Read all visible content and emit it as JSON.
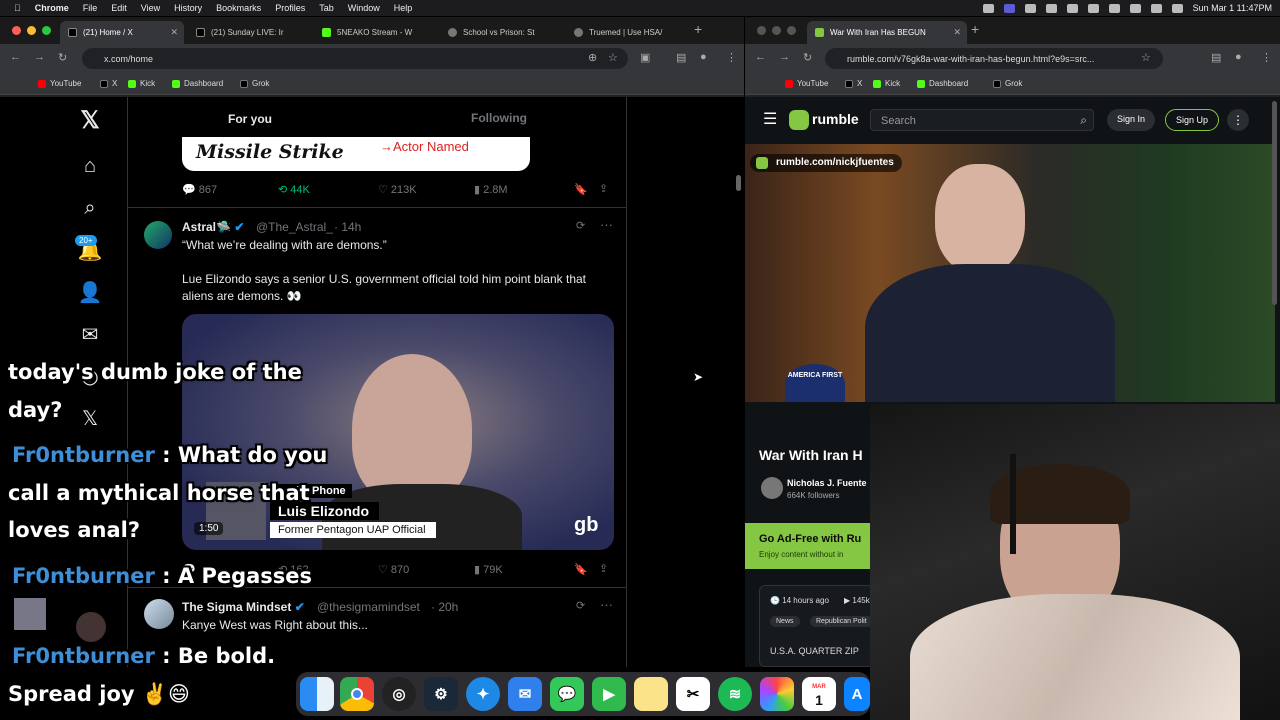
{
  "menubar": {
    "app": "Chrome",
    "items": [
      "File",
      "Edit",
      "View",
      "History",
      "Bookmarks",
      "Profiles",
      "Tab",
      "Window",
      "Help"
    ],
    "datetime": "Sun Mar 1  11:47PM"
  },
  "left_browser": {
    "tabs": [
      {
        "label": "(21) Home / X",
        "active": true
      },
      {
        "label": "(21) Sunday LIVE: Ir",
        "active": false
      },
      {
        "label": "5NEAKO Stream - W",
        "active": false
      },
      {
        "label": "School vs Prison: St",
        "active": false
      },
      {
        "label": "Truemed | Use HSA/",
        "active": false
      }
    ],
    "url": "x.com/home",
    "bookmarks": [
      "YouTube",
      "X",
      "Kick",
      "Dashboard",
      "Grok"
    ]
  },
  "x": {
    "tabs": {
      "for_you": "For you",
      "following": "Following"
    },
    "notif_badge": "20+",
    "image_text_left": "Missile Strike",
    "image_text_right": "→Actor Named",
    "post1_stats": {
      "replies": "867",
      "reposts": "44K",
      "likes": "213K",
      "views": "2.8M"
    },
    "post2": {
      "name": "Astral",
      "name_emoji": "🛸",
      "handle": "@The_Astral_",
      "time": "· 14h",
      "line1": "“What we’re dealing with are demons.”",
      "line2": "Lue Elizondo says a senior U.S. government official told him point blank that aliens are demons. 👀",
      "video": {
        "phone_label": "on the Phone",
        "name": "Luis Elizondo",
        "title": "Former Pentagon UAP Official",
        "duration": "1:50",
        "logo": "gb"
      },
      "stats": {
        "replies": "",
        "reposts": "162",
        "likes": "870",
        "views": "79K"
      }
    },
    "post3": {
      "name": "The Sigma Mindset",
      "handle": "@thesigmamindset",
      "time": "· 20h",
      "text": "Kanye West was Right about this..."
    }
  },
  "chat_overlay": [
    {
      "user": "",
      "message": "today's dumb joke of the"
    },
    {
      "user": "",
      "message": "day?"
    },
    {
      "user": "Fr0ntburner",
      "message": " : What do you"
    },
    {
      "user": "",
      "message": "call a mythical horse that"
    },
    {
      "user": "",
      "message": "loves anal?"
    },
    {
      "user": "Fr0ntburner",
      "message": " : A Pegasses"
    },
    {
      "user": "Fr0ntburner",
      "message": " : Be bold."
    },
    {
      "user": "",
      "message": "Spread joy ✌️😄"
    }
  ],
  "right_browser": {
    "tab": "War With Iran Has BEGUN",
    "url": "rumble.com/v76gk8a-war-with-iran-has-begun.html?e9s=src...",
    "bookmarks": [
      "YouTube",
      "X",
      "Kick",
      "Dashboard",
      "Grok"
    ]
  },
  "rumble": {
    "logo": "rumble",
    "search_placeholder": "Search",
    "sign_in": "Sign In",
    "sign_up": "Sign Up",
    "channel_url": "rumble.com/nickjfuentes",
    "hat_text": "AMERICA FIRST",
    "video_title": "War With Iran H",
    "channel_name": "Nicholas J. Fuente",
    "followers": "664K followers",
    "adfree_title": "Go Ad-Free with Ru",
    "adfree_sub": "Enjoy content without in",
    "time_ago": "14 hours ago",
    "views": "145k",
    "tags": [
      "News",
      "Republican Polit"
    ],
    "desc": "U.S.A. QUARTER ZIP"
  },
  "dock": {
    "calendar_month": "MAR",
    "calendar_day": "1"
  }
}
